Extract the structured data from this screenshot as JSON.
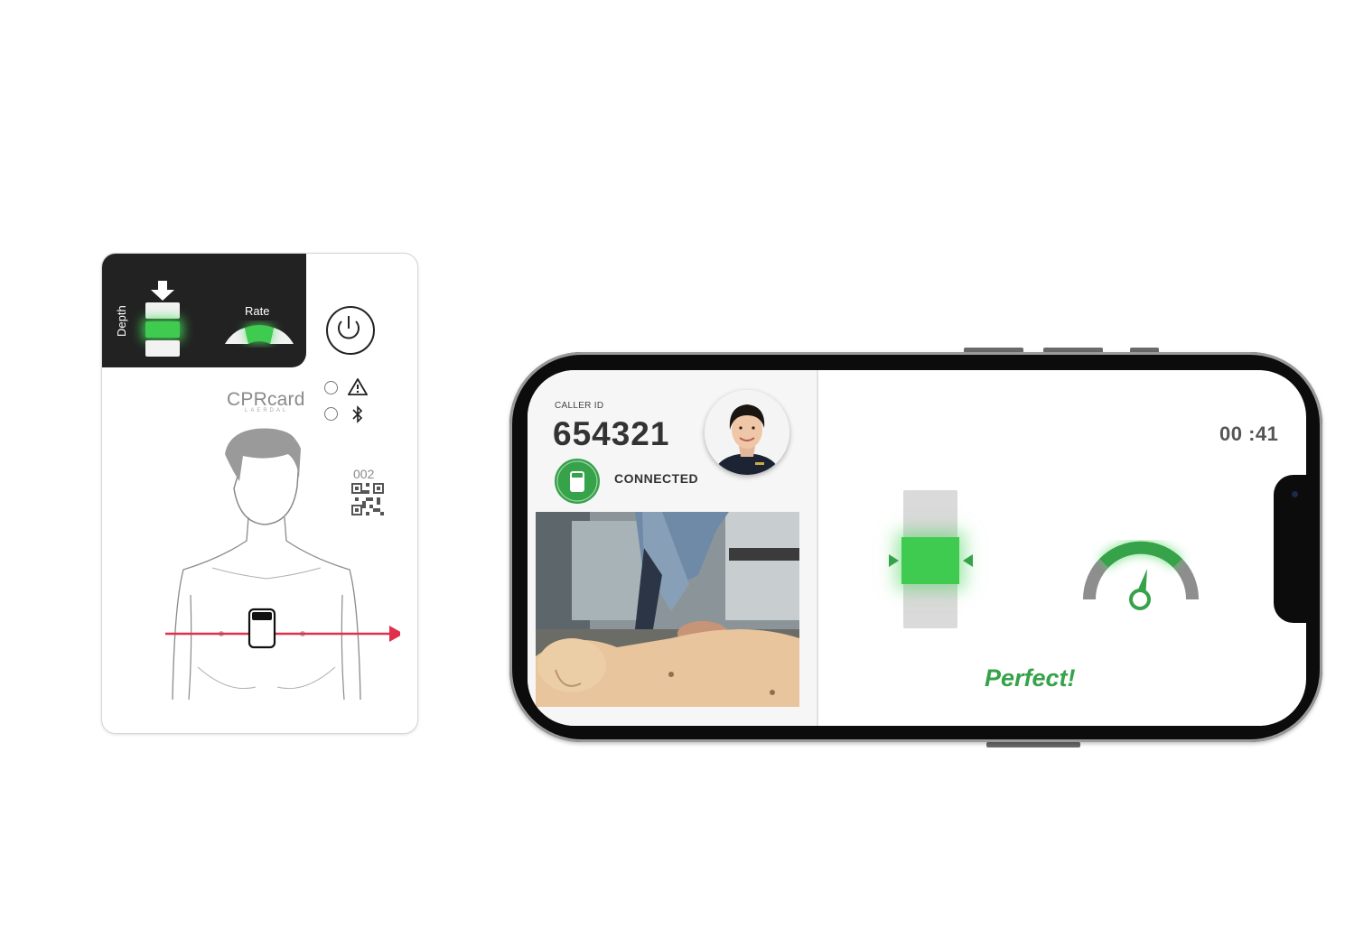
{
  "card": {
    "depth_label": "Depth",
    "rate_label": "Rate",
    "brand_main": "CPR",
    "brand_suffix": "card",
    "brand_sub": "LAERDAL",
    "serial": "002"
  },
  "call": {
    "caller_id_label": "CALLER ID",
    "caller_id": "654321",
    "status": "CONNECTED",
    "timer": "00 :41",
    "feedback": "Perfect!"
  },
  "colors": {
    "accent_green": "#36a24a",
    "glow_green": "#3ecb50",
    "arrow_red": "#e0304b",
    "card_dark": "#222222"
  },
  "icons": [
    "depth-arrow-icon",
    "power-icon",
    "warning-icon",
    "bluetooth-icon",
    "qr-code-icon",
    "card-device-icon",
    "rate-gauge-icon"
  ]
}
